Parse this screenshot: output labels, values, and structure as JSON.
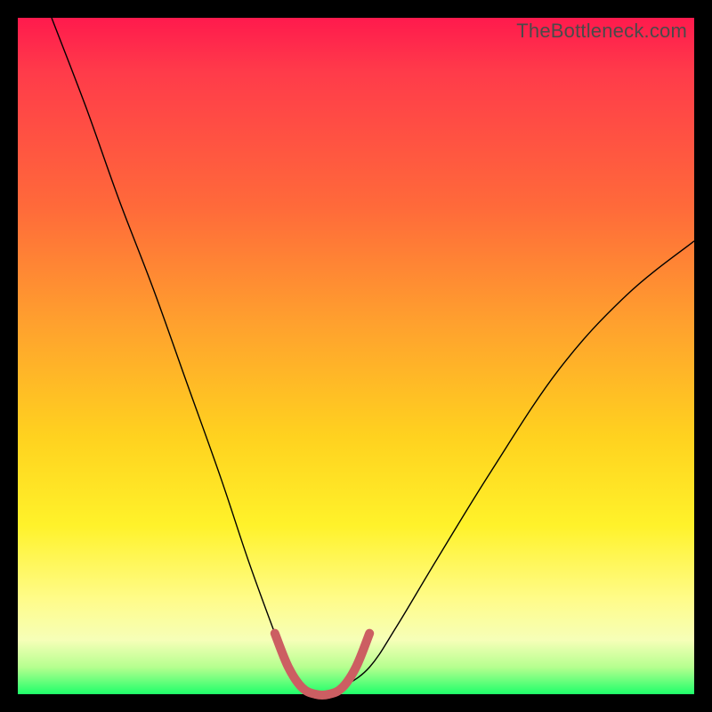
{
  "watermark": "TheBottleneck.com",
  "chart_data": {
    "type": "line",
    "title": "",
    "xlabel": "",
    "ylabel": "",
    "xlim": [
      0,
      100
    ],
    "ylim": [
      0,
      100
    ],
    "grid": false,
    "legend": false,
    "series": [
      {
        "name": "bottleneck-curve",
        "x": [
          5,
          10,
          15,
          20,
          25,
          30,
          34,
          38,
          40,
          42,
          44,
          46,
          48,
          52,
          56,
          62,
          70,
          80,
          90,
          100
        ],
        "y": [
          100,
          87,
          73,
          60,
          46,
          32,
          20,
          9,
          4,
          1,
          0,
          0,
          1,
          4,
          10,
          20,
          33,
          48,
          59,
          67
        ],
        "color": "#000000",
        "width": 1.4
      },
      {
        "name": "optimal-zone-marker",
        "x": [
          38,
          40,
          42,
          44,
          46,
          48,
          50,
          52
        ],
        "y": [
          9,
          4,
          1,
          0,
          0,
          1,
          4,
          9
        ],
        "color": "#cc5e62",
        "width": 10
      }
    ],
    "background_gradient": {
      "top": "#ff1a4d",
      "mid": "#ffd21f",
      "bottom": "#1fff6a"
    }
  }
}
